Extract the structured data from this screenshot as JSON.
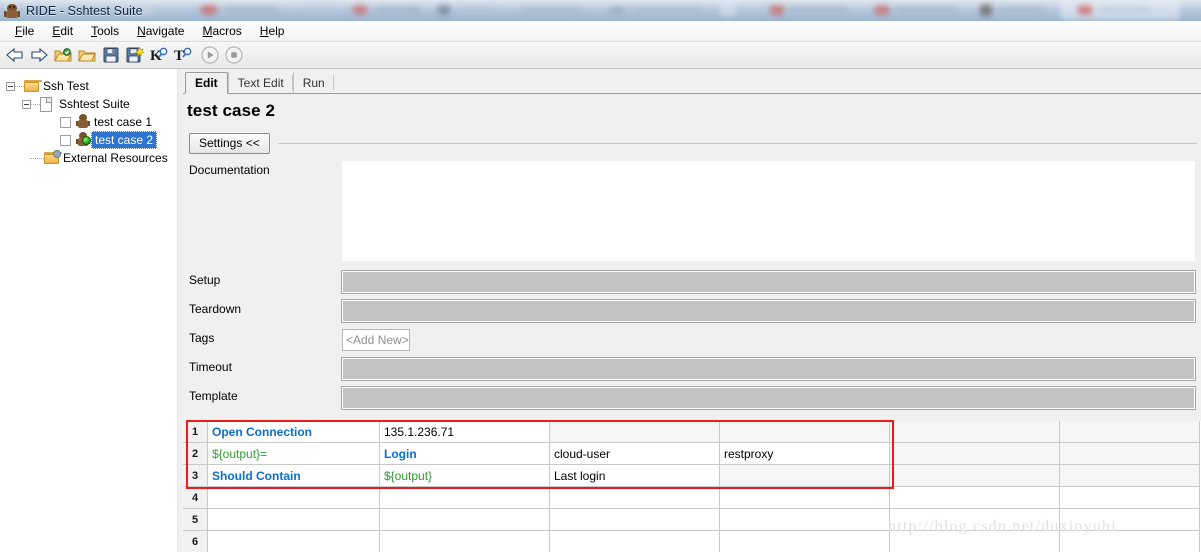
{
  "window": {
    "title": "RIDE - Sshtest Suite",
    "icon": "robot-icon"
  },
  "menubar": [
    {
      "label": "File",
      "mnemonic": "F"
    },
    {
      "label": "Edit",
      "mnemonic": "E"
    },
    {
      "label": "Tools",
      "mnemonic": "T"
    },
    {
      "label": "Navigate",
      "mnemonic": "N"
    },
    {
      "label": "Macros",
      "mnemonic": "M"
    },
    {
      "label": "Help",
      "mnemonic": "H"
    }
  ],
  "toolbar": [
    {
      "name": "back-arrow-icon",
      "glyph": "⇦",
      "tooltip": "Back"
    },
    {
      "name": "forward-arrow-icon",
      "glyph": "⇨",
      "tooltip": "Forward"
    },
    {
      "name": "open-directory-icon",
      "glyph": "",
      "tooltip": "Open Directory"
    },
    {
      "name": "open-folder-icon",
      "glyph": "",
      "tooltip": "Open"
    },
    {
      "name": "save-icon",
      "glyph": "",
      "tooltip": "Save"
    },
    {
      "name": "save-all-icon",
      "glyph": "",
      "tooltip": "Save All"
    },
    {
      "name": "search-keywords-icon",
      "glyph": "K",
      "tooltip": "Search Keywords"
    },
    {
      "name": "search-tests-icon",
      "glyph": "T",
      "tooltip": "Search Tests"
    },
    {
      "name": "run-icon",
      "glyph": "▶",
      "tooltip": "Run"
    },
    {
      "name": "stop-icon",
      "glyph": "■",
      "tooltip": "Stop"
    }
  ],
  "sidebar": {
    "tree": [
      {
        "label": "Ssh Test",
        "icon": "folder-icon",
        "depth": 0,
        "expander": "minus",
        "checkbox": false,
        "selected": false
      },
      {
        "label": "Sshtest Suite",
        "icon": "document-icon",
        "depth": 1,
        "expander": "minus",
        "checkbox": false,
        "selected": false
      },
      {
        "label": "test case 1",
        "icon": "test-case-icon",
        "depth": 2,
        "expander": "none",
        "checkbox": true,
        "selected": false
      },
      {
        "label": "test case 2",
        "icon": "test-case-running-icon",
        "depth": 2,
        "expander": "none",
        "checkbox": true,
        "selected": true
      },
      {
        "label": "External Resources",
        "icon": "resource-folder-icon",
        "depth": 1,
        "expander": "none",
        "checkbox": false,
        "selected": false
      }
    ]
  },
  "editor": {
    "tabs": [
      {
        "label": "Edit",
        "active": true
      },
      {
        "label": "Text Edit",
        "active": false
      },
      {
        "label": "Run",
        "active": false
      }
    ],
    "title": "test case 2",
    "settings_button": "Settings <<",
    "fields": {
      "documentation": {
        "label": "Documentation",
        "value": "",
        "placeholder": ""
      },
      "setup": {
        "label": "Setup",
        "value": ""
      },
      "teardown": {
        "label": "Teardown",
        "value": ""
      },
      "tags": {
        "label": "Tags",
        "add_new": "<Add New>"
      },
      "timeout": {
        "label": "Timeout",
        "value": ""
      },
      "template": {
        "label": "Template",
        "value": ""
      }
    }
  },
  "steps_grid": {
    "rows": [
      {
        "num": "1",
        "cells": [
          {
            "text": "Open Connection",
            "style": "keyword"
          },
          {
            "text": "135.1.236.71",
            "style": "plain"
          },
          {
            "text": "",
            "style": "plain"
          },
          {
            "text": "",
            "style": "plain"
          },
          {
            "text": "",
            "style": "plain"
          },
          {
            "text": "",
            "style": "plain"
          }
        ]
      },
      {
        "num": "2",
        "cells": [
          {
            "text": "${output}=",
            "style": "variable"
          },
          {
            "text": "Login",
            "style": "keyword"
          },
          {
            "text": "cloud-user",
            "style": "plain"
          },
          {
            "text": "restproxy",
            "style": "plain"
          },
          {
            "text": "",
            "style": "plain"
          },
          {
            "text": "",
            "style": "plain"
          }
        ]
      },
      {
        "num": "3",
        "cells": [
          {
            "text": "Should Contain",
            "style": "keyword"
          },
          {
            "text": "${output}",
            "style": "variable"
          },
          {
            "text": "Last login",
            "style": "plain"
          },
          {
            "text": "",
            "style": "plain"
          },
          {
            "text": "",
            "style": "plain"
          },
          {
            "text": "",
            "style": "plain"
          }
        ]
      },
      {
        "num": "4",
        "cells": [
          {
            "text": "",
            "style": "plain"
          },
          {
            "text": "",
            "style": "plain"
          },
          {
            "text": "",
            "style": "plain"
          },
          {
            "text": "",
            "style": "plain"
          },
          {
            "text": "",
            "style": "plain"
          },
          {
            "text": "",
            "style": "plain"
          }
        ]
      },
      {
        "num": "5",
        "cells": [
          {
            "text": "",
            "style": "plain"
          },
          {
            "text": "",
            "style": "plain"
          },
          {
            "text": "",
            "style": "plain"
          },
          {
            "text": "",
            "style": "plain"
          },
          {
            "text": "",
            "style": "plain"
          },
          {
            "text": "",
            "style": "plain"
          }
        ]
      },
      {
        "num": "6",
        "cells": [
          {
            "text": "",
            "style": "plain"
          },
          {
            "text": "",
            "style": "plain"
          },
          {
            "text": "",
            "style": "plain"
          },
          {
            "text": "",
            "style": "plain"
          },
          {
            "text": "",
            "style": "plain"
          },
          {
            "text": "",
            "style": "plain"
          }
        ]
      }
    ]
  },
  "annotation": {
    "highlight_color": "#ee1b1b",
    "note": ""
  },
  "watermark": "http://blog.csdn.net/duxinyuhi",
  "colors": {
    "keyword_blue": "#0b6fd1",
    "variable_green": "#2f9e2f",
    "selection_blue": "#2f74d0",
    "window_gray": "#f0f0f0",
    "field_gray": "#c3c3c3"
  }
}
